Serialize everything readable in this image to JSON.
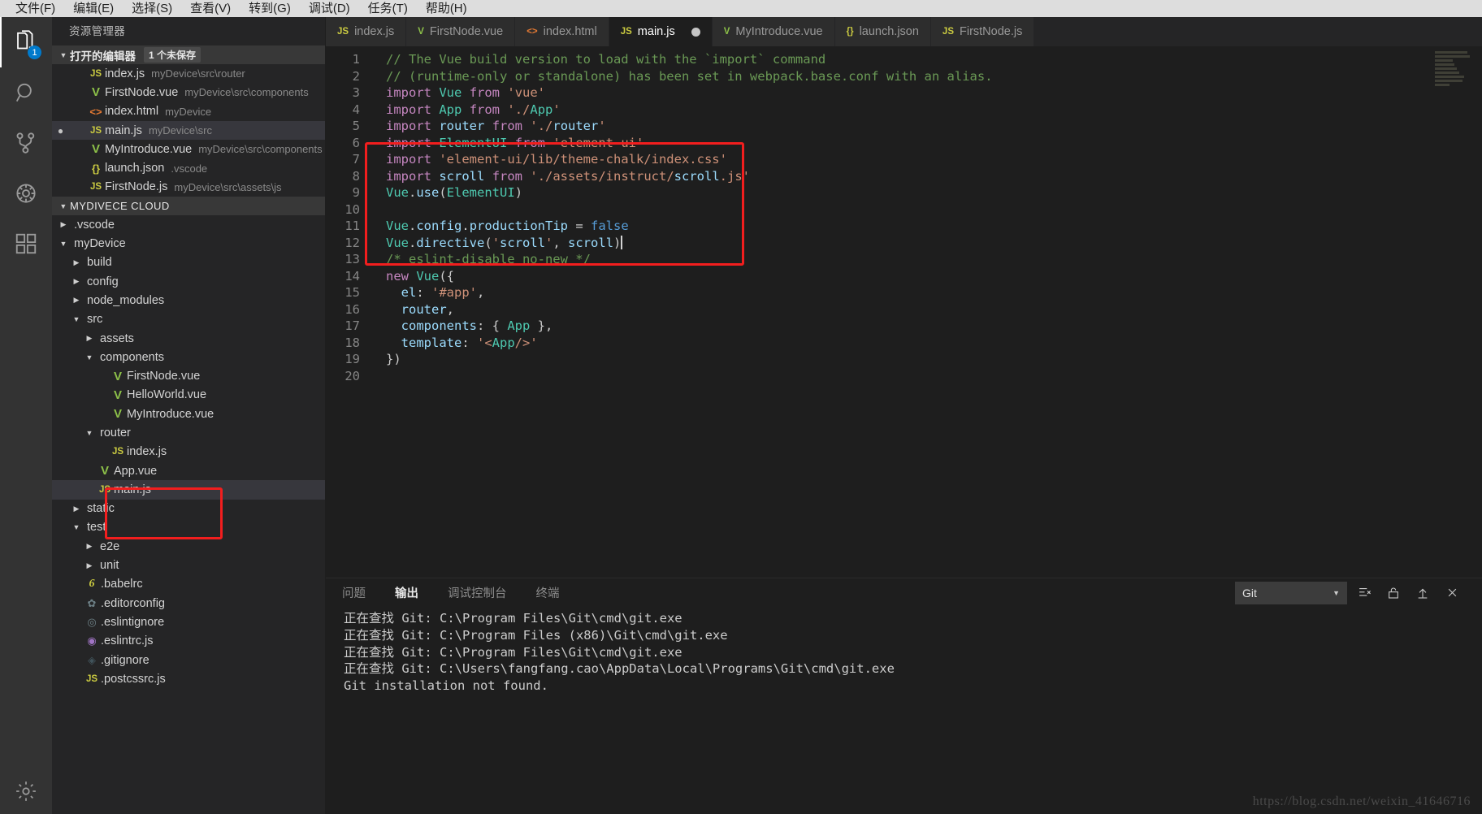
{
  "menubar": {
    "items": [
      {
        "label": "文件(F)"
      },
      {
        "label": "编辑(E)"
      },
      {
        "label": "选择(S)"
      },
      {
        "label": "查看(V)"
      },
      {
        "label": "转到(G)"
      },
      {
        "label": "调试(D)"
      },
      {
        "label": "任务(T)"
      },
      {
        "label": "帮助(H)"
      }
    ]
  },
  "activitybar": {
    "items": [
      {
        "name": "explorer",
        "icon": "files-icon",
        "badge": "1",
        "active": true
      },
      {
        "name": "search",
        "icon": "search-icon",
        "badge": "",
        "active": false
      },
      {
        "name": "source-control",
        "icon": "source-control-icon",
        "badge": "",
        "active": false
      },
      {
        "name": "debug",
        "icon": "debug-icon",
        "badge": "",
        "active": false
      },
      {
        "name": "extensions",
        "icon": "extensions-icon",
        "badge": "",
        "active": false
      }
    ],
    "settings_icon": "gear-icon"
  },
  "sidebar": {
    "title": "资源管理器",
    "open_editors": {
      "label": "打开的编辑器",
      "badge": "1 个未保存",
      "items": [
        {
          "icon": "js",
          "name": "index.js",
          "path": "myDevice\\src\\router",
          "dirty": false,
          "selected": false
        },
        {
          "icon": "vue",
          "name": "FirstNode.vue",
          "path": "myDevice\\src\\components",
          "dirty": false,
          "selected": false
        },
        {
          "icon": "html",
          "name": "index.html",
          "path": "myDevice",
          "dirty": false,
          "selected": false
        },
        {
          "icon": "js",
          "name": "main.js",
          "path": "myDevice\\src",
          "dirty": true,
          "selected": true
        },
        {
          "icon": "vue",
          "name": "MyIntroduce.vue",
          "path": "myDevice\\src\\components",
          "dirty": false,
          "selected": false
        },
        {
          "icon": "json",
          "name": "launch.json",
          "path": ".vscode",
          "dirty": false,
          "selected": false
        },
        {
          "icon": "js",
          "name": "FirstNode.js",
          "path": "myDevice\\src\\assets\\js",
          "dirty": false,
          "selected": false
        }
      ]
    },
    "project": {
      "label": "MYDIVECE CLOUD",
      "tree": [
        {
          "depth": 1,
          "kind": "folder",
          "state": "collapsed",
          "name": ".vscode"
        },
        {
          "depth": 1,
          "kind": "folder",
          "state": "expanded",
          "name": "myDevice"
        },
        {
          "depth": 2,
          "kind": "folder",
          "state": "collapsed",
          "name": "build"
        },
        {
          "depth": 2,
          "kind": "folder",
          "state": "collapsed",
          "name": "config"
        },
        {
          "depth": 2,
          "kind": "folder",
          "state": "collapsed",
          "name": "node_modules"
        },
        {
          "depth": 2,
          "kind": "folder",
          "state": "expanded",
          "name": "src"
        },
        {
          "depth": 3,
          "kind": "folder",
          "state": "collapsed",
          "name": "assets"
        },
        {
          "depth": 3,
          "kind": "folder",
          "state": "expanded",
          "name": "components"
        },
        {
          "depth": 4,
          "kind": "file",
          "icon": "vue",
          "name": "FirstNode.vue"
        },
        {
          "depth": 4,
          "kind": "file",
          "icon": "vue",
          "name": "HelloWorld.vue"
        },
        {
          "depth": 4,
          "kind": "file",
          "icon": "vue",
          "name": "MyIntroduce.vue"
        },
        {
          "depth": 3,
          "kind": "folder",
          "state": "expanded",
          "name": "router"
        },
        {
          "depth": 4,
          "kind": "file",
          "icon": "js",
          "name": "index.js"
        },
        {
          "depth": 3,
          "kind": "file",
          "icon": "vue",
          "name": "App.vue"
        },
        {
          "depth": 3,
          "kind": "file",
          "icon": "js",
          "name": "main.js",
          "selected": true
        },
        {
          "depth": 2,
          "kind": "folder",
          "state": "collapsed",
          "name": "static"
        },
        {
          "depth": 2,
          "kind": "folder",
          "state": "expanded",
          "name": "test"
        },
        {
          "depth": 3,
          "kind": "folder",
          "state": "collapsed",
          "name": "e2e"
        },
        {
          "depth": 3,
          "kind": "folder",
          "state": "collapsed",
          "name": "unit"
        },
        {
          "depth": 2,
          "kind": "file",
          "icon": "babel",
          "name": ".babelrc"
        },
        {
          "depth": 2,
          "kind": "file",
          "icon": "gear",
          "name": ".editorconfig"
        },
        {
          "depth": 2,
          "kind": "file",
          "icon": "eslint1",
          "name": ".eslintignore"
        },
        {
          "depth": 2,
          "kind": "file",
          "icon": "eslint2",
          "name": ".eslintrc.js"
        },
        {
          "depth": 2,
          "kind": "file",
          "icon": "git",
          "name": ".gitignore"
        },
        {
          "depth": 2,
          "kind": "file",
          "icon": "js",
          "name": ".postcssrc.js"
        }
      ]
    }
  },
  "tabs": [
    {
      "icon": "js",
      "label": "index.js",
      "active": false,
      "dirty": false
    },
    {
      "icon": "vue",
      "label": "FirstNode.vue",
      "active": false,
      "dirty": false
    },
    {
      "icon": "html",
      "label": "index.html",
      "active": false,
      "dirty": false
    },
    {
      "icon": "js",
      "label": "main.js",
      "active": true,
      "dirty": true
    },
    {
      "icon": "vue",
      "label": "MyIntroduce.vue",
      "active": false,
      "dirty": false
    },
    {
      "icon": "json",
      "label": "launch.json",
      "active": false,
      "dirty": false
    },
    {
      "icon": "js",
      "label": "FirstNode.js",
      "active": false,
      "dirty": false
    }
  ],
  "editor": {
    "first_line": 1,
    "last_line": 20,
    "lines": [
      "// The Vue build version to load with the `import` command",
      "// (runtime-only or standalone) has been set in webpack.base.conf with an alias.",
      "import Vue from 'vue'",
      "import App from './App'",
      "import router from './router'",
      "import ElementUI from 'element-ui'",
      "import 'element-ui/lib/theme-chalk/index.css'",
      "import scroll from './assets/instruct/scroll.js'",
      "Vue.use(ElementUI)",
      "",
      "Vue.config.productionTip = false",
      "Vue.directive('scroll', scroll)",
      "/* eslint-disable no-new */",
      "new Vue({",
      "  el: '#app',",
      "  router,",
      "  components: { App },",
      "  template: '<App/>'",
      "})",
      ""
    ],
    "cursor_line": 12,
    "annotation_color": "#f21e1e"
  },
  "panel": {
    "tabs": [
      {
        "label": "问题",
        "active": false
      },
      {
        "label": "输出",
        "active": true
      },
      {
        "label": "调试控制台",
        "active": false
      },
      {
        "label": "终端",
        "active": false
      }
    ],
    "channel_selected": "Git",
    "actions": [
      {
        "name": "clear-output-icon"
      },
      {
        "name": "lock-icon"
      },
      {
        "name": "maximize-panel-icon"
      },
      {
        "name": "close-panel-icon"
      }
    ],
    "output_lines": [
      "正在查找 Git: C:\\Program Files\\Git\\cmd\\git.exe",
      "正在查找 Git: C:\\Program Files (x86)\\Git\\cmd\\git.exe",
      "正在查找 Git: C:\\Program Files\\Git\\cmd\\git.exe",
      "正在查找 Git: C:\\Users\\fangfang.cao\\AppData\\Local\\Programs\\Git\\cmd\\git.exe",
      "Git installation not found."
    ]
  },
  "watermark": "https://blog.csdn.net/weixin_41646716"
}
